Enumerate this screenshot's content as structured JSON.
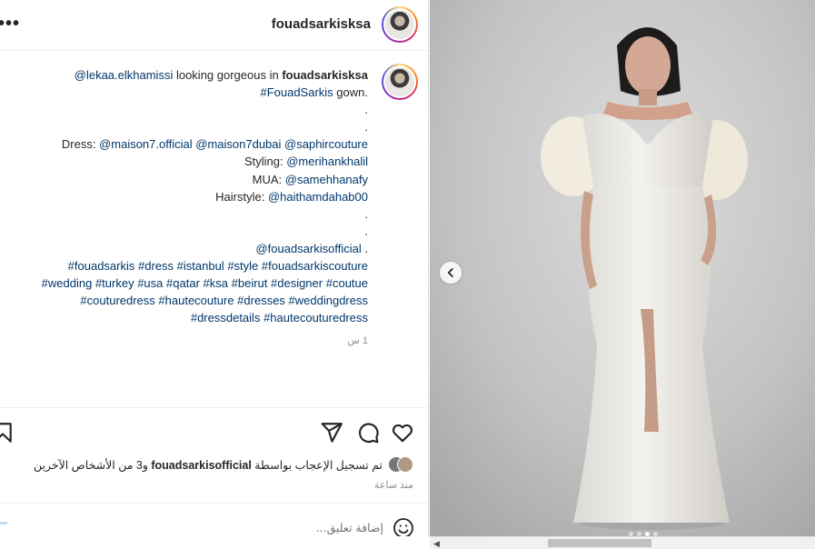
{
  "header": {
    "more_icon": "more-horizontal-icon",
    "username": "fouadsarkisksa"
  },
  "caption": {
    "line1": {
      "mention": "@lekaa.elkhamissi",
      "text": " looking gorgeous in ",
      "brand": "fouadsarkisksa"
    },
    "line2": {
      "hashtag": "#FouadSarkis",
      "text": " gown."
    },
    "dot": ".",
    "dress": {
      "label": "Dress: ",
      "m1": "@maison7.official",
      "m2": "@maison7dubai",
      "m3": "@saphircouture"
    },
    "styling": {
      "label": "Styling: ",
      "mention": "@merihankhalil"
    },
    "mua": {
      "label": "MUA: ",
      "mention": "@samehhanafy"
    },
    "hairstyle": {
      "label": "Hairstyle: ",
      "mention": "@haithamdahab00"
    },
    "official": {
      "mention": "@fouadsarkisofficial",
      "text": " ."
    },
    "tags1": [
      "#fouadsarkis",
      "#dress",
      "#istanbul",
      "#style",
      "#fouadsarkiscouture"
    ],
    "tags2": [
      "#wedding",
      "#turkey",
      "#usa",
      "#qatar",
      "#ksa",
      "#beirut",
      "#designer",
      "#coutue"
    ],
    "tags3": [
      "#couturedress",
      "#hautecouture",
      "#dresses",
      "#weddingdress"
    ],
    "tags4": [
      "#dressdetails",
      "#hautecouturedress"
    ],
    "timestamp": "1 س"
  },
  "actions": {
    "like_icon": "heart-icon",
    "comment_icon": "comment-icon",
    "share_icon": "paper-plane-icon",
    "save_icon": "bookmark-icon"
  },
  "likes": {
    "prefix": "تم تسجيل الإعجاب بواسطة ",
    "user": "fouadsarkisofficial",
    "suffix": " و3 من الأشخاص الآخرين",
    "time_ago": "منذ ساعة"
  },
  "comment": {
    "placeholder": "إضافة تعليق...",
    "emoji_icon": "smiley-icon"
  },
  "photo": {
    "prev_icon": "chevron-left-icon",
    "dots_count": 4,
    "active_dot": 2
  },
  "colors": {
    "link": "#00376b",
    "text": "#262626",
    "muted": "#8e8e8e",
    "border": "#dbdbdb",
    "avatar_ring": [
      "#feda75",
      "#fa7e1e",
      "#d62976",
      "#962fbf",
      "#4f5bd5"
    ]
  }
}
